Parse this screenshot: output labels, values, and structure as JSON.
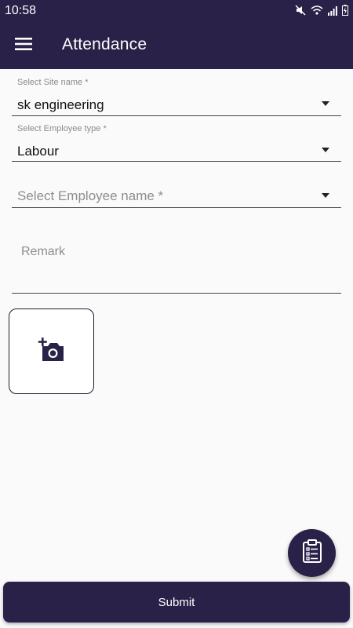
{
  "status_bar": {
    "time": "10:58",
    "icons": [
      "mute-icon",
      "wifi-icon",
      "signal-icon",
      "battery-icon"
    ]
  },
  "app_bar": {
    "title": "Attendance",
    "menu_icon": "hamburger-menu-icon",
    "background": "#2a2148"
  },
  "form": {
    "site": {
      "label": "Select Site name *",
      "value": "sk engineering"
    },
    "employee_type": {
      "label": "Select Employee type *",
      "value": "Labour"
    },
    "employee_name": {
      "placeholder": "Select Employee name *"
    },
    "remark": {
      "placeholder": "Remark"
    },
    "photo": {
      "icon": "add-photo-camera-icon"
    }
  },
  "fab": {
    "icon": "clipboard-checklist-icon"
  },
  "submit": {
    "label": "Submit"
  },
  "colors": {
    "primary": "#2a2148",
    "background": "#fafafa"
  }
}
